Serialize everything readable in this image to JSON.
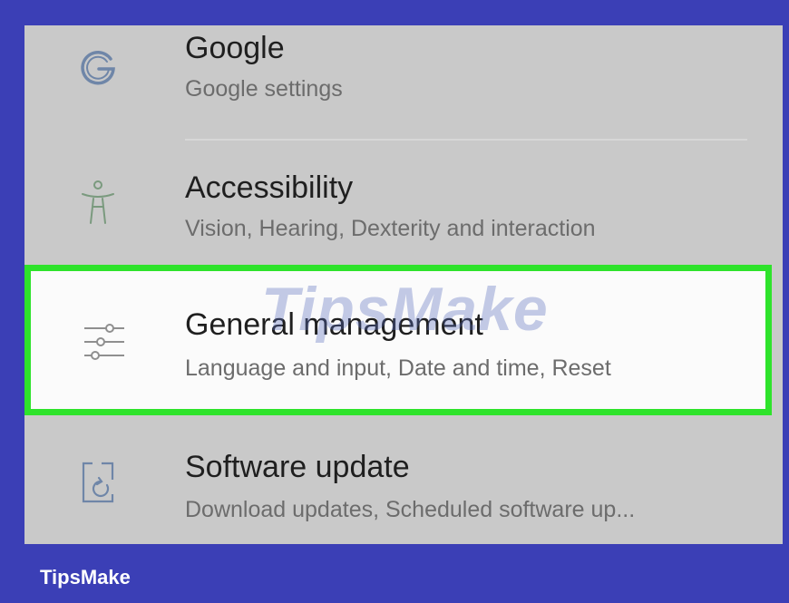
{
  "settings": {
    "items": [
      {
        "title": "Google",
        "subtitle": "Google settings",
        "icon": "google-icon"
      },
      {
        "title": "Accessibility",
        "subtitle": "Vision, Hearing, Dexterity and interaction",
        "icon": "accessibility-icon"
      },
      {
        "title": "General management",
        "subtitle": "Language and input, Date and time, Reset",
        "icon": "sliders-icon"
      },
      {
        "title": "Software update",
        "subtitle": "Download updates, Scheduled software up...",
        "icon": "software-update-icon"
      }
    ]
  },
  "watermark": "TipsMake",
  "brand": "TipsMake",
  "colors": {
    "frame": "#3b3fb6",
    "highlight": "#2ee32b",
    "list_bg": "#c9c9c9"
  }
}
